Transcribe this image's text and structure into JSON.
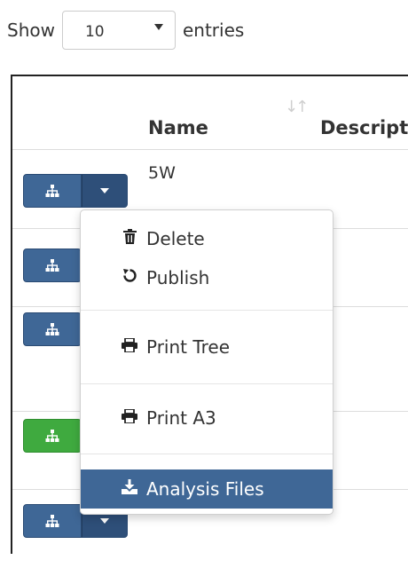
{
  "length_control": {
    "show_label": "Show",
    "selected": "10",
    "entries_label": "entries"
  },
  "table": {
    "columns": {
      "name": "Name",
      "description": "Descript"
    },
    "rows": [
      {
        "name": "5W",
        "button_color": "#3f6796"
      },
      {
        "name": "",
        "button_color": "#3f6796"
      },
      {
        "name": "",
        "button_color": "#3f6796"
      },
      {
        "name": "",
        "button_color": "#3faa3f"
      },
      {
        "name": "",
        "button_color": "#3f6796"
      }
    ]
  },
  "dropdown": {
    "items": [
      {
        "label": "Delete",
        "icon": "trash-icon"
      },
      {
        "label": "Publish",
        "icon": "undo-icon"
      },
      {
        "label": "Print Tree",
        "icon": "print-icon"
      },
      {
        "label": "Print A3",
        "icon": "print-icon"
      },
      {
        "label": "Analysis Files",
        "icon": "download-icon"
      }
    ]
  },
  "colors": {
    "primary_button": "#3f6796",
    "success_button": "#3faa3f",
    "active_menu": "#3f6796"
  }
}
